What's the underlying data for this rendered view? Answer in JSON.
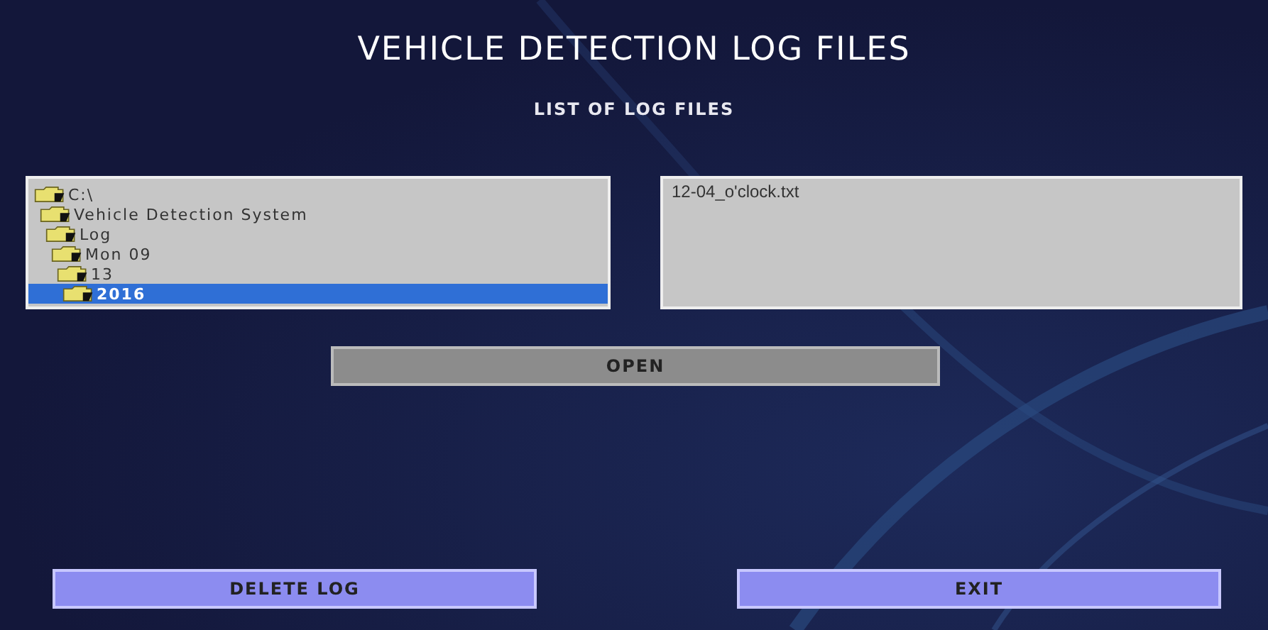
{
  "title": "VEHICLE DETECTION LOG FILES",
  "subtitle": "LIST OF LOG FILES",
  "folder_tree": [
    {
      "label": "C:\\",
      "selected": false,
      "children": [
        {
          "label": "Vehicle Detection System",
          "selected": false,
          "children": [
            {
              "label": "Log",
              "selected": false,
              "children": [
                {
                  "label": "Mon 09",
                  "selected": false,
                  "children": [
                    {
                      "label": "13",
                      "selected": false,
                      "children": [
                        {
                          "label": "2016",
                          "selected": true
                        }
                      ]
                    }
                  ]
                }
              ]
            }
          ]
        }
      ]
    }
  ],
  "files": [
    {
      "name": "12-04_o'clock.txt",
      "selected": false
    }
  ],
  "open_button": "OPEN",
  "buttons": [
    {
      "label": "DELETE LOG"
    },
    {
      "label": "EXIT"
    }
  ]
}
